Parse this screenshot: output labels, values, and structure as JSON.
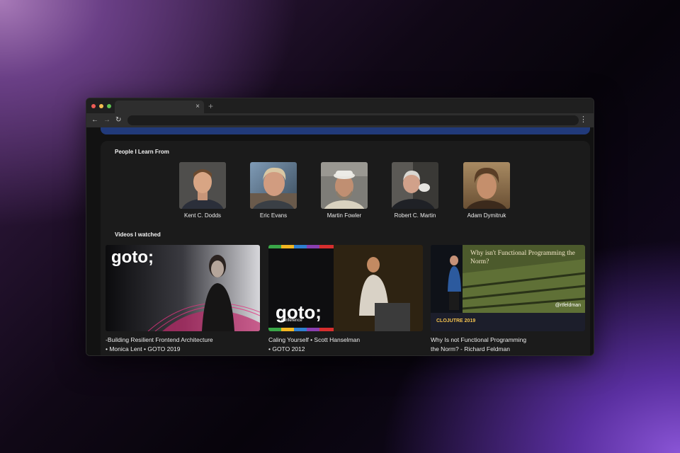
{
  "browser": {
    "tab_close": "×",
    "new_tab": "+",
    "back": "←",
    "forward": "→",
    "reload": "↻",
    "menu": "⋮"
  },
  "people": {
    "title": "People I Learn From",
    "items": [
      {
        "name": "Kent C. Dodds"
      },
      {
        "name": "Eric Evans"
      },
      {
        "name": "Martin Fowler"
      },
      {
        "name": "Robert C. Martin"
      },
      {
        "name": "Adam Dymitruk"
      }
    ]
  },
  "videos": {
    "title": "Videos I watched",
    "items": [
      {
        "line1": "-Building Resilient Frontend Architecture",
        "line2": "• Monica Lent • GOTO 2019",
        "logo": "goto;"
      },
      {
        "line1": "Caling Yourself • Scott Hanselman",
        "line2": "• GOTO 2012",
        "logo": "goto;",
        "logo_sub": "conference"
      },
      {
        "line1": "Why Is not Functional Programming",
        "line2": "the Norm? - Richard Feldman",
        "overlay_title": "Why isn't Functional Programming the Norm?",
        "handle": "@rtfeldman",
        "event": "CLOJUTRE 2019"
      }
    ]
  },
  "colors": {
    "accent": "#213a7a",
    "card": "#1b1b1b",
    "background": "#121212"
  }
}
